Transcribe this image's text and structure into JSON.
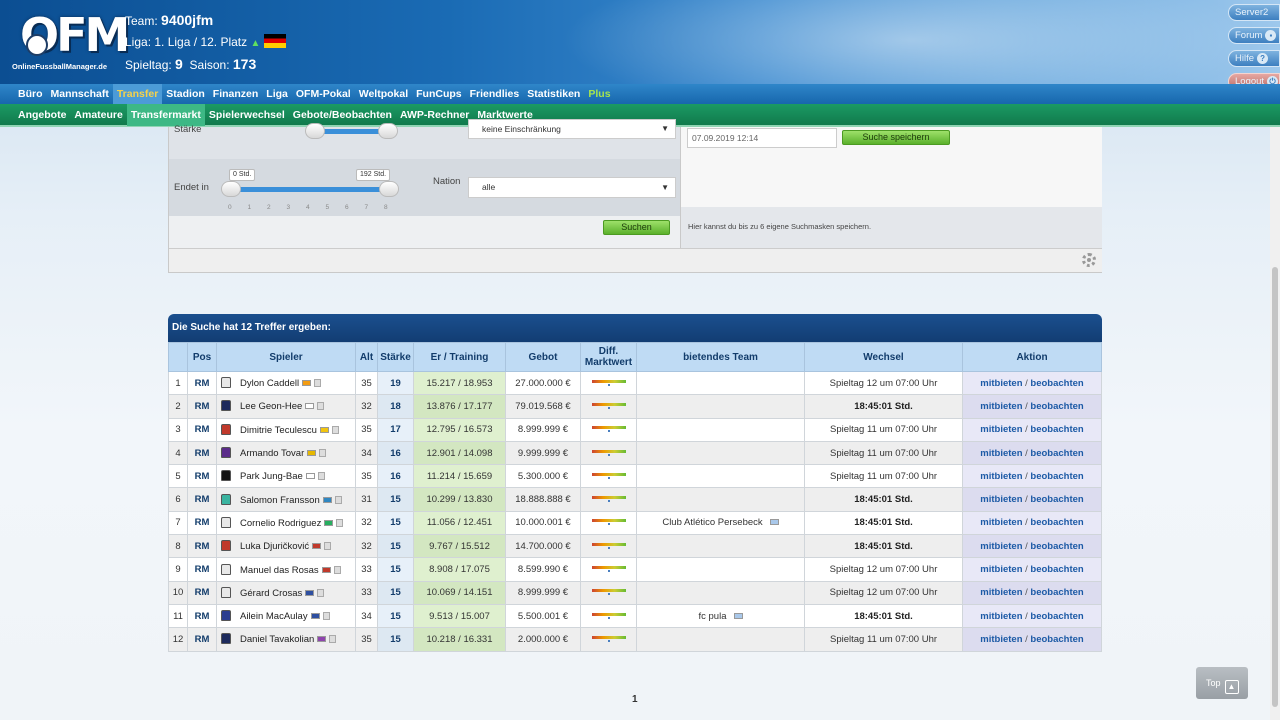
{
  "header": {
    "logo_text": "OFM",
    "logo_sub": "OnlineFussballManager.de",
    "team_label": "Team:",
    "team_name": "9400jfm",
    "league_label": "Liga:",
    "league": "1. Liga",
    "league_sep": "/",
    "rank": "12. Platz",
    "matchday_label": "Spieltag:",
    "matchday": "9",
    "season_label": "Saison:",
    "season": "173"
  },
  "right_buttons": {
    "server": "Server2",
    "forum": "Forum",
    "help": "Hilfe",
    "logout": "Logout"
  },
  "nav_main": [
    "Büro",
    "Mannschaft",
    "Transfer",
    "Stadion",
    "Finanzen",
    "Liga",
    "OFM-Pokal",
    "Weltpokal",
    "FunCups",
    "Friendlies",
    "Statistiken",
    "Plus"
  ],
  "nav_main_active": "Transfer",
  "nav_sub": [
    "Angebote",
    "Amateure",
    "Transfermarkt",
    "Spielerwechsel",
    "Gebote/Beobachten",
    "AWP-Rechner",
    "Marktwerte"
  ],
  "nav_sub_active": "Transfermarkt",
  "search": {
    "staerke_label": "Stärke",
    "restriction_value": "keine Einschränkung",
    "endet_label": "Endet in",
    "endet_min": "0 Std.",
    "endet_max": "192 Std.",
    "ticks": [
      "0",
      "1",
      "2",
      "3",
      "4",
      "5",
      "6",
      "7",
      "8"
    ],
    "nation_label": "Nation",
    "nation_value": "alle",
    "search_button": "Suchen",
    "date_value": "07.09.2019 12:14",
    "save_button": "Suche speichern",
    "save_hint": "Hier kannst du bis zu 6 eigene Suchmasken speichern."
  },
  "results": {
    "title": "Die Suche hat 12 Treffer ergeben:",
    "columns": [
      "",
      "Pos",
      "Spieler",
      "Alt",
      "Stärke",
      "Er / Training",
      "Gebot",
      "Diff. Marktwert",
      "bietendes Team",
      "Wechsel",
      "Aktion"
    ],
    "action_bid": "mitbieten",
    "action_sep": "/",
    "action_watch": "beobachten",
    "rows": [
      {
        "n": "1",
        "pos": "RM",
        "name": "Dylon Caddell",
        "alt": "35",
        "st": "19",
        "er": "15.217 / 18.953",
        "gebot": "27.000.000 €",
        "team": "",
        "wechsel": "Spieltag 12 um 07:00 Uhr",
        "bold": false,
        "shirt": "#e8e8e8",
        "flag": "#f39c12"
      },
      {
        "n": "2",
        "pos": "RM",
        "name": "Lee Geon-Hee",
        "alt": "32",
        "st": "18",
        "er": "13.876 / 17.177",
        "gebot": "79.019.568 €",
        "team": "",
        "wechsel": "18:45:01 Std.",
        "bold": true,
        "shirt": "#1d2a5c",
        "flag": "#ffffff"
      },
      {
        "n": "3",
        "pos": "RM",
        "name": "Dimitrie Teculescu",
        "alt": "35",
        "st": "17",
        "er": "12.795 / 16.573",
        "gebot": "8.999.999 €",
        "team": "",
        "wechsel": "Spieltag 11 um 07:00 Uhr",
        "bold": false,
        "shirt": "#c0392b",
        "flag": "#f1c40f"
      },
      {
        "n": "4",
        "pos": "RM",
        "name": "Armando Tovar",
        "alt": "34",
        "st": "16",
        "er": "12.901 / 14.098",
        "gebot": "9.999.999 €",
        "team": "",
        "wechsel": "Spieltag 11 um 07:00 Uhr",
        "bold": false,
        "shirt": "#5b2c8a",
        "flag": "#e6b800"
      },
      {
        "n": "5",
        "pos": "RM",
        "name": "Park Jung-Bae",
        "alt": "35",
        "st": "16",
        "er": "11.214 / 15.659",
        "gebot": "5.300.000 €",
        "team": "",
        "wechsel": "Spieltag 11 um 07:00 Uhr",
        "bold": false,
        "shirt": "#111111",
        "flag": "#ffffff"
      },
      {
        "n": "6",
        "pos": "RM",
        "name": "Salomon Fransson",
        "alt": "31",
        "st": "15",
        "er": "10.299 / 13.830",
        "gebot": "18.888.888 €",
        "team": "",
        "wechsel": "18:45:01 Std.",
        "bold": true,
        "shirt": "#3ab4a0",
        "flag": "#2e86c1"
      },
      {
        "n": "7",
        "pos": "RM",
        "name": "Cornelio Rodriguez",
        "alt": "32",
        "st": "15",
        "er": "11.056 / 12.451",
        "gebot": "10.000.001 €",
        "team": "Club Atlético Persebeck",
        "wechsel": "18:45:01 Std.",
        "bold": true,
        "shirt": "#e8e8e8",
        "flag": "#27ae60"
      },
      {
        "n": "8",
        "pos": "RM",
        "name": "Luka Djuričković",
        "alt": "32",
        "st": "15",
        "er": "9.767 / 15.512",
        "gebot": "14.700.000 €",
        "team": "",
        "wechsel": "18:45:01 Std.",
        "bold": true,
        "shirt": "#c0392b",
        "flag": "#c0392b"
      },
      {
        "n": "9",
        "pos": "RM",
        "name": "Manuel das Rosas",
        "alt": "33",
        "st": "15",
        "er": "8.908 / 17.075",
        "gebot": "8.599.990 €",
        "team": "",
        "wechsel": "Spieltag 12 um 07:00 Uhr",
        "bold": false,
        "shirt": "#e8e8e8",
        "flag": "#c0392b"
      },
      {
        "n": "10",
        "pos": "RM",
        "name": "Gérard Crosas",
        "alt": "33",
        "st": "15",
        "er": "10.069 / 14.151",
        "gebot": "8.999.999 €",
        "team": "",
        "wechsel": "Spieltag 12 um 07:00 Uhr",
        "bold": false,
        "shirt": "#e8e8e8",
        "flag": "#2e4fa0"
      },
      {
        "n": "11",
        "pos": "RM",
        "name": "Ailein MacAulay",
        "alt": "34",
        "st": "15",
        "er": "9.513 / 15.007",
        "gebot": "5.500.001 €",
        "team": "fc pula",
        "wechsel": "18:45:01 Std.",
        "bold": true,
        "shirt": "#2b3d8f",
        "flag": "#2e4fa0"
      },
      {
        "n": "12",
        "pos": "RM",
        "name": "Daniel Tavakolian",
        "alt": "35",
        "st": "15",
        "er": "10.218 / 16.331",
        "gebot": "2.000.000 €",
        "team": "",
        "wechsel": "Spieltag 11 um 07:00 Uhr",
        "bold": false,
        "shirt": "#1d2a5c",
        "flag": "#8e44ad"
      }
    ]
  },
  "pager": {
    "current": "1"
  },
  "top_button": "Top"
}
